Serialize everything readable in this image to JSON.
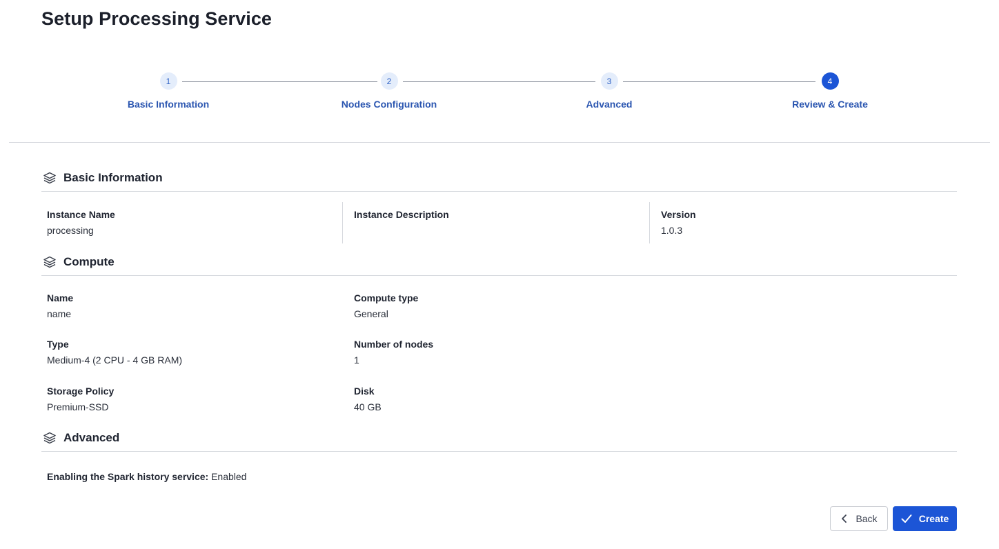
{
  "page": {
    "title": "Setup Processing Service"
  },
  "stepper": {
    "steps": [
      {
        "number": "1",
        "label": "Basic Information",
        "active": false
      },
      {
        "number": "2",
        "label": "Nodes Configuration",
        "active": false
      },
      {
        "number": "3",
        "label": "Advanced",
        "active": false
      },
      {
        "number": "4",
        "label": "Review & Create",
        "active": true
      }
    ]
  },
  "sections": {
    "basic": {
      "title": "Basic Information",
      "icon": "layers-icon",
      "fields": {
        "instance_name": {
          "label": "Instance Name",
          "value": "processing"
        },
        "instance_description": {
          "label": "Instance Description",
          "value": ""
        },
        "version": {
          "label": "Version",
          "value": "1.0.3"
        }
      }
    },
    "compute": {
      "title": "Compute",
      "icon": "layers-icon",
      "fields": {
        "name": {
          "label": "Name",
          "value": "name"
        },
        "compute_type": {
          "label": "Compute type",
          "value": "General"
        },
        "type": {
          "label": "Type",
          "value": "Medium-4 (2 CPU - 4 GB RAM)"
        },
        "number_of_nodes": {
          "label": "Number of nodes",
          "value": "1"
        },
        "storage_policy": {
          "label": "Storage Policy",
          "value": "Premium-SSD"
        },
        "disk": {
          "label": "Disk",
          "value": "40 GB"
        }
      }
    },
    "advanced": {
      "title": "Advanced",
      "icon": "layers-icon",
      "fields": {
        "spark_history": {
          "label": "Enabling the Spark history service:",
          "value": "Enabled"
        }
      }
    }
  },
  "actions": {
    "back_label": "Back",
    "create_label": "Create"
  },
  "colors": {
    "accent": "#1c55d6",
    "step_label": "#2a55b0",
    "divider": "#d6d9de"
  }
}
